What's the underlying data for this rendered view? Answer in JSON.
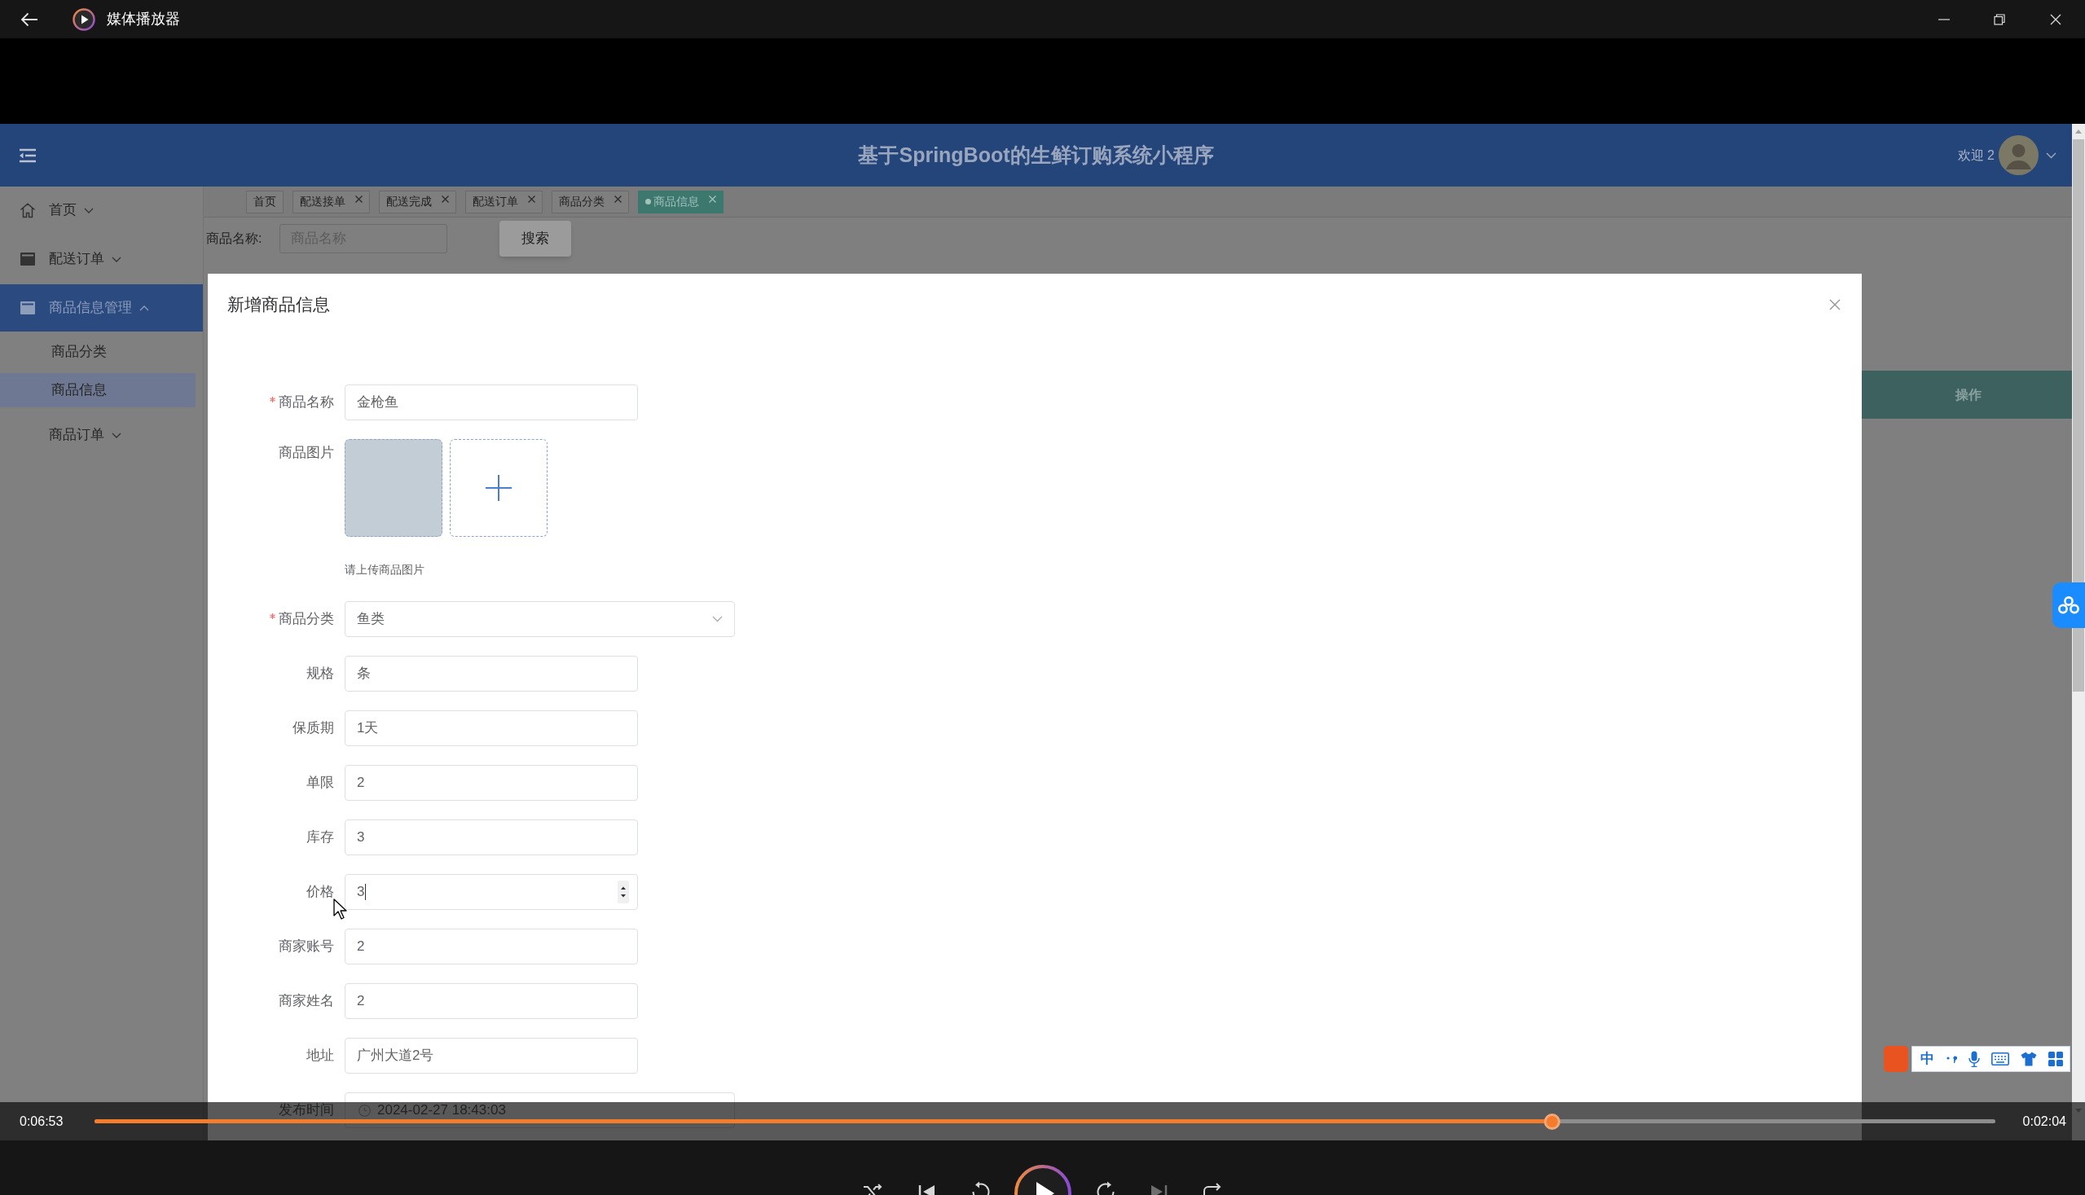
{
  "window": {
    "title": "媒体播放器"
  },
  "header": {
    "title": "基于SpringBoot的生鲜订购系统小程序",
    "welcome": "欢迎 2"
  },
  "sidebar": {
    "items": [
      {
        "label": "首页",
        "selected": false,
        "expanded": false
      },
      {
        "label": "配送订单",
        "selected": false,
        "expanded": false
      },
      {
        "label": "商品信息管理",
        "selected": true,
        "expanded": true,
        "children": [
          {
            "label": "商品分类",
            "selected": false
          },
          {
            "label": "商品信息",
            "selected": true
          }
        ]
      },
      {
        "label": "商品订单",
        "selected": false,
        "expanded": false
      }
    ]
  },
  "tabs": [
    {
      "label": "首页",
      "closable": false,
      "selected": false
    },
    {
      "label": "配送接单",
      "closable": true,
      "selected": false
    },
    {
      "label": "配送完成",
      "closable": true,
      "selected": false
    },
    {
      "label": "配送订单",
      "closable": true,
      "selected": false
    },
    {
      "label": "商品分类",
      "closable": true,
      "selected": false
    },
    {
      "label": "商品信息",
      "closable": true,
      "selected": true
    }
  ],
  "search": {
    "label": "商品名称:",
    "placeholder": "商品名称",
    "button": "搜索"
  },
  "table": {
    "columns": [
      {
        "label": "操作"
      }
    ]
  },
  "dialog": {
    "title": "新增商品信息",
    "fields": [
      {
        "kind": "text",
        "label": "商品名称",
        "required": true,
        "value": "金枪鱼",
        "focused": false
      },
      {
        "kind": "upload",
        "label": "商品图片",
        "required": false,
        "hint": "请上传商品图片"
      },
      {
        "kind": "select",
        "label": "商品分类",
        "required": true,
        "value": "鱼类"
      },
      {
        "kind": "text",
        "label": "规格",
        "required": false,
        "value": "条",
        "focused": false
      },
      {
        "kind": "text",
        "label": "保质期",
        "required": false,
        "value": "1天",
        "focused": false
      },
      {
        "kind": "text",
        "label": "单限",
        "required": false,
        "value": "2",
        "focused": false
      },
      {
        "kind": "text",
        "label": "库存",
        "required": false,
        "value": "3",
        "focused": false
      },
      {
        "kind": "number",
        "label": "价格",
        "required": false,
        "value": "3",
        "focused": true
      },
      {
        "kind": "text",
        "label": "商家账号",
        "required": false,
        "value": "2",
        "focused": false
      },
      {
        "kind": "text",
        "label": "商家姓名",
        "required": false,
        "value": "2",
        "focused": false
      },
      {
        "kind": "text",
        "label": "地址",
        "required": false,
        "value": "广州大道2号",
        "focused": false
      },
      {
        "kind": "datetime",
        "label": "发布时间",
        "required": false,
        "value": "2024-02-27 18:43:03"
      }
    ]
  },
  "player": {
    "elapsed": "0:06:53",
    "remaining": "0:02:04",
    "progress": {
      "level": 0.767
    },
    "next_disabled": true
  },
  "input_method": {
    "mode": "中"
  }
}
